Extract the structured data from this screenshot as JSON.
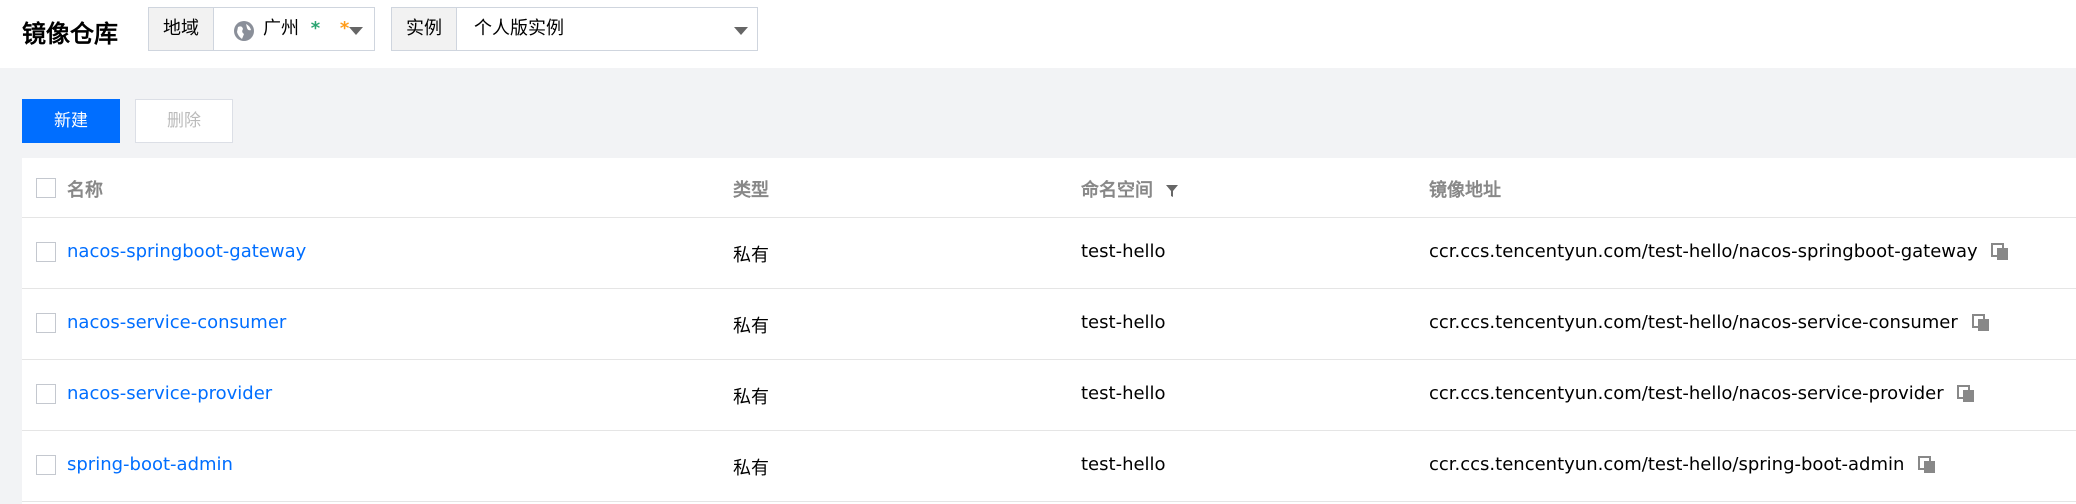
{
  "header": {
    "title": "镜像仓库",
    "region": {
      "label": "地域",
      "value": "广州",
      "stars": [
        "*",
        "*"
      ],
      "icon": "globe-icon"
    },
    "instance": {
      "label": "实例",
      "value": "个人版实例"
    }
  },
  "toolbar": {
    "new_label": "新建",
    "delete_label": "删除"
  },
  "table": {
    "columns": [
      "名称",
      "类型",
      "命名空间",
      "镜像地址"
    ],
    "rows": [
      {
        "name": "nacos-springboot-gateway",
        "type": "私有",
        "namespace": "test-hello",
        "address": "ccr.ccs.tencentyun.com/test-hello/nacos-springboot-gateway"
      },
      {
        "name": "nacos-service-consumer",
        "type": "私有",
        "namespace": "test-hello",
        "address": "ccr.ccs.tencentyun.com/test-hello/nacos-service-consumer"
      },
      {
        "name": "nacos-service-provider",
        "type": "私有",
        "namespace": "test-hello",
        "address": "ccr.ccs.tencentyun.com/test-hello/nacos-service-provider"
      },
      {
        "name": "spring-boot-admin",
        "type": "私有",
        "namespace": "test-hello",
        "address": "ccr.ccs.tencentyun.com/test-hello/spring-boot-admin"
      }
    ]
  },
  "colors": {
    "accent": "#006eff",
    "star_green": "#2ba471",
    "star_orange": "#ff9c19"
  }
}
